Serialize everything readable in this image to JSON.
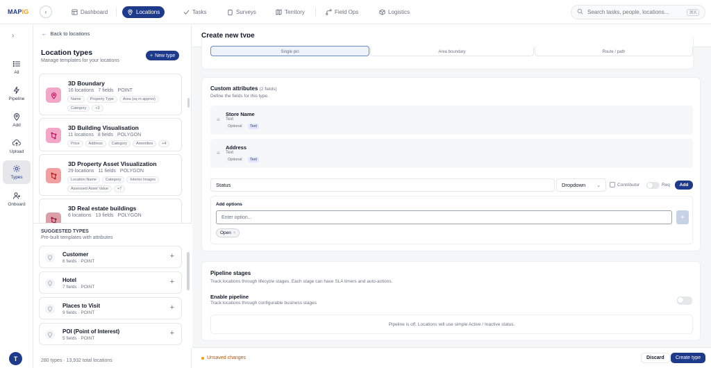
{
  "app": {
    "logo_main": "MAP",
    "logo_accent": "IG"
  },
  "nav": {
    "back_glyph": "‹",
    "items": [
      {
        "label": "Dashboard",
        "icon": "dashboard-icon"
      },
      {
        "label": "Locations",
        "icon": "pin-icon",
        "active": true
      },
      {
        "label": "Tasks",
        "icon": "check-icon"
      },
      {
        "label": "Surveys",
        "icon": "clipboard-icon"
      },
      {
        "label": "Territory",
        "icon": "map-icon"
      },
      {
        "label": "Field Ops",
        "icon": "route-icon"
      },
      {
        "label": "Logistics",
        "icon": "box-icon"
      }
    ]
  },
  "search": {
    "placeholder": "Search tasks, people, locations...",
    "shortcut": "⌘K"
  },
  "rail": {
    "items": [
      {
        "label": "All",
        "icon": "list-icon"
      },
      {
        "label": "Pipeline",
        "icon": "pipeline-icon"
      },
      {
        "label": "Add",
        "icon": "pin-icon"
      },
      {
        "label": "Upload",
        "icon": "upload-icon"
      },
      {
        "label": "Types",
        "icon": "gear-icon",
        "active": true
      },
      {
        "label": "Onboard",
        "icon": "user-add-icon"
      }
    ],
    "avatar_initial": "T"
  },
  "panel": {
    "back_label": "Back to locations",
    "title": "Location types",
    "subtitle": "Manage templates for your locations",
    "new_type_label": "New type",
    "types": [
      {
        "name": "3D Boundary",
        "locations": "16 locations",
        "fields": "7 fields",
        "geometry": "POINT",
        "color": "#f3a7c8",
        "icon_color": "#be185d",
        "tags": [
          "Name",
          "Property Type",
          "Area (sq m approx)",
          "Category",
          "+3"
        ]
      },
      {
        "name": "3D Building Visualisation",
        "locations": "11 locations",
        "fields": "8 fields",
        "geometry": "POLYGON",
        "color": "#f3a7c8",
        "icon_color": "#be185d",
        "tags": [
          "Price",
          "Address",
          "Category",
          "Amenities",
          "+4"
        ]
      },
      {
        "name": "3D Property Asset Visualization",
        "locations": "29 locations",
        "fields": "11 fields",
        "geometry": "POLYGON",
        "color": "#f0a0a0",
        "icon_color": "#b91c1c",
        "tags": [
          "Location Name",
          "Category",
          "Interior Images",
          "Assessed Asset Value",
          "+7"
        ]
      },
      {
        "name": "3D Real estate buildings",
        "locations": "6 locations",
        "fields": "13 fields",
        "geometry": "POLYGON",
        "color": "#d9a0a8",
        "icon_color": "#9f1239",
        "tags": []
      }
    ],
    "suggested_title": "SUGGESTED TYPES",
    "suggested_sub": "Pre-built templates with attributes",
    "suggested": [
      {
        "name": "Customer",
        "meta": "6 fields · POINT"
      },
      {
        "name": "Hotel",
        "meta": "7 fields · POINT"
      },
      {
        "name": "Places to Visit",
        "meta": "9 fields · POINT"
      },
      {
        "name": "POI (Point of Interest)",
        "meta": "5 fields · POINT"
      }
    ],
    "footer": "280 types · 13,932 total locations"
  },
  "main": {
    "title": "Create new type",
    "geometry_options": [
      "Single pin",
      "Area boundary",
      "Route / path"
    ],
    "custom_attrs": {
      "title": "Custom attributes",
      "count": "(2 fields)",
      "subtitle": "Define the fields for this type.",
      "items": [
        {
          "name": "Store Name",
          "type": "Text",
          "badge1": "Optional",
          "badge2": "Text"
        },
        {
          "name": "Address",
          "type": "Text",
          "badge1": "Optional",
          "badge2": "Text"
        }
      ],
      "new_field_value": "Status",
      "new_field_type": "Dropdown",
      "contributor_label": "Contributor",
      "req_label": "Req",
      "add_label": "Add",
      "add_options_label": "Add options",
      "option_placeholder": "Enter option...",
      "option_chip": "Open"
    },
    "pipeline": {
      "title": "Pipeline stages",
      "subtitle": "Track locations through lifecycle stages. Each stage can have SLA timers and auto-actions.",
      "enable_label": "Enable pipeline",
      "enable_sub": "Track locations through configurable business stages",
      "off_message": "Pipeline is off. Locations will use simple Active / Inactive status."
    },
    "footer": {
      "unsaved": "Unsaved changes",
      "discard": "Discard",
      "create": "Create type"
    }
  }
}
